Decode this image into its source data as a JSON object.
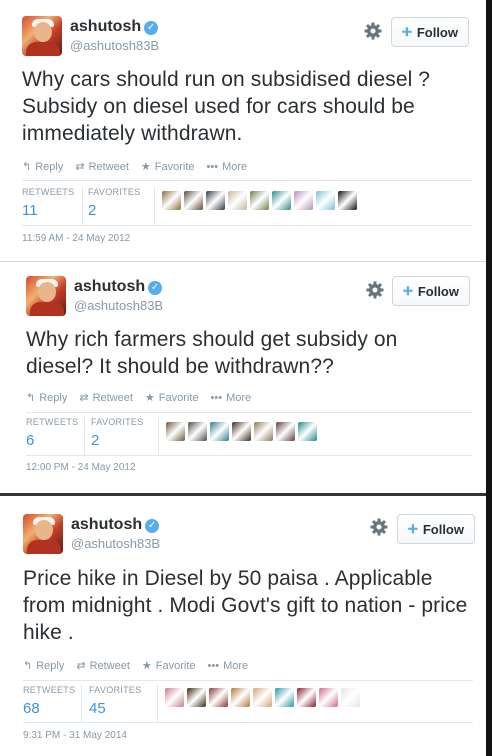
{
  "actions": {
    "reply": "Reply",
    "retweet": "Retweet",
    "favorite": "Favorite",
    "more": "More"
  },
  "labels": {
    "follow": "Follow",
    "retweets": "RETWEETS",
    "favorites": "FAVORITES"
  },
  "icons": {
    "verified": "verified-badge",
    "settings": "gear-icon",
    "follow": "add-user-icon",
    "reply": "reply-arrow-icon",
    "retweet": "retweet-icon",
    "favorite": "star-icon",
    "more": "ellipsis-icon"
  },
  "colors": {
    "link_blue": "#3b94d9",
    "verified_blue": "#55acee",
    "muted_text": "#8899a6"
  },
  "tweets": [
    {
      "name": "ashutosh",
      "handle": "@ashutosh83B",
      "text": "Why cars should run on subsidised diesel ? Subsidy on diesel used for cars should be immediately withdrawn.",
      "retweets": "11",
      "favorites": "2",
      "timestamp": "11:59 AM - 24 May 2012",
      "favoriter_colors": [
        "#8a6d3b",
        "#5b4b3a",
        "#2d3b46",
        "#c9b79c",
        "#6f7f4a",
        "#2e8b8b",
        "#b88fc0",
        "#79c2d8",
        "#111111"
      ]
    },
    {
      "name": "ashutosh",
      "handle": "@ashutosh83B",
      "text": "Why rich farmers should get subsidy on diesel? It should be withdrawn??",
      "retweets": "6",
      "favorites": "2",
      "timestamp": "12:00 PM - 24 May 2012",
      "favoriter_colors": [
        "#6e5a3c",
        "#4d4d4d",
        "#2f7f8a",
        "#3a2a1e",
        "#8c7a5a",
        "#5a3d3d",
        "#1f8a86"
      ]
    },
    {
      "name": "ashutosh",
      "handle": "@ashutosh83B",
      "text": "Price hike in Diesel by 50 paisa . Applicable from midnight . Modi Govt's gift to nation - price hike .",
      "retweets": "68",
      "favorites": "45",
      "timestamp": "9:31 PM - 31 May 2014",
      "favoriter_colors": [
        "#c77c8a",
        "#3a2a14",
        "#8b3a2e",
        "#b07a3a",
        "#d4a27a",
        "#2a9aa6",
        "#8a1f2e",
        "#d46a8a",
        "#e6e6e6"
      ]
    }
  ]
}
